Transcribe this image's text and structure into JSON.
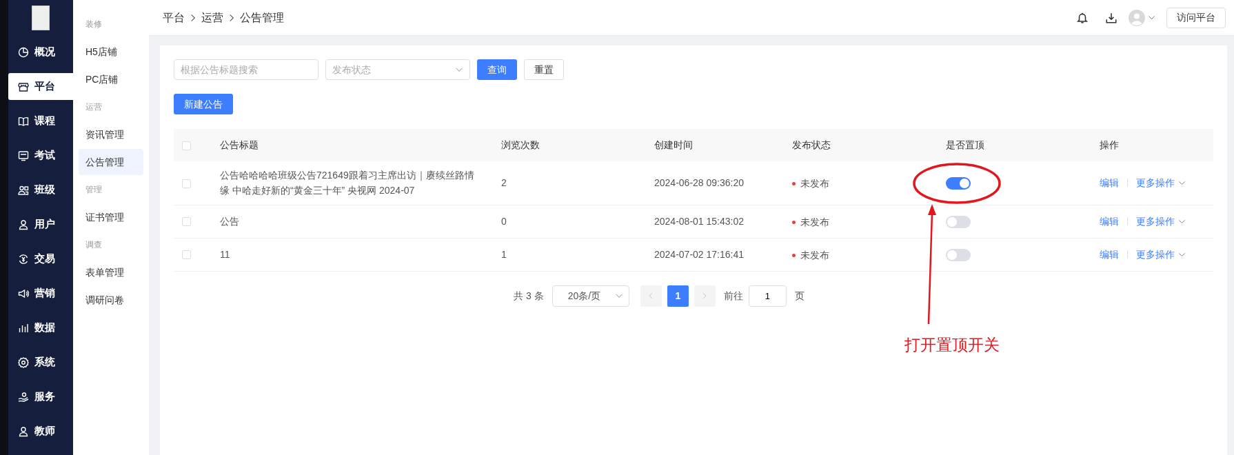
{
  "nav": [
    {
      "label": "概况",
      "selected": false
    },
    {
      "label": "平台",
      "selected": true
    },
    {
      "label": "课程",
      "selected": false
    },
    {
      "label": "考试",
      "selected": false
    },
    {
      "label": "班级",
      "selected": false
    },
    {
      "label": "用户",
      "selected": false
    },
    {
      "label": "交易",
      "selected": false
    },
    {
      "label": "营销",
      "selected": false
    },
    {
      "label": "数据",
      "selected": false
    },
    {
      "label": "系统",
      "selected": false
    },
    {
      "label": "服务",
      "selected": false
    },
    {
      "label": "教师",
      "selected": false
    }
  ],
  "submenu": [
    {
      "group": "装修",
      "items": [
        {
          "label": "H5店铺",
          "selected": false
        },
        {
          "label": "PC店铺",
          "selected": false
        }
      ]
    },
    {
      "group": "运营",
      "items": [
        {
          "label": "资讯管理",
          "selected": false
        },
        {
          "label": "公告管理",
          "selected": true
        }
      ]
    },
    {
      "group": "管理",
      "items": [
        {
          "label": "证书管理",
          "selected": false
        }
      ]
    },
    {
      "group": "调查",
      "items": [
        {
          "label": "表单管理",
          "selected": false
        },
        {
          "label": "调研问卷",
          "selected": false
        }
      ]
    }
  ],
  "breadcrumb": [
    "平台",
    "运营",
    "公告管理"
  ],
  "header_button": "访问平台",
  "filters": {
    "search_placeholder": "根据公告标题搜索",
    "status_placeholder": "发布状态",
    "query_button": "查询",
    "reset_button": "重置"
  },
  "create_button": "新建公告",
  "table": {
    "select_all_checked": false,
    "columns": [
      "公告标题",
      "浏览次数",
      "创建时间",
      "发布状态",
      "是否置顶",
      "操作"
    ],
    "rows": [
      {
        "checked": false,
        "title": "公告哈哈哈哈班级公告721649跟着习主席出访｜赓续丝路情缘 中哈走好新的“黄金三十年” 央视网 2024-07",
        "views": "2",
        "created": "2024-06-28 09:36:20",
        "status": "未发布",
        "pinned": true,
        "actions": [
          "编辑",
          "更多操作"
        ]
      },
      {
        "checked": false,
        "title": "公告",
        "views": "0",
        "created": "2024-08-01 15:43:02",
        "status": "未发布",
        "pinned": false,
        "actions": [
          "编辑",
          "更多操作"
        ]
      },
      {
        "checked": false,
        "title": "11",
        "views": "1",
        "created": "2024-07-02 17:16:41",
        "status": "未发布",
        "pinned": false,
        "actions": [
          "编辑",
          "更多操作"
        ]
      }
    ]
  },
  "pagination": {
    "total": "共 3 条",
    "page_size": "20条/页",
    "pages": [
      {
        "label": "1",
        "selected": true
      }
    ],
    "goto_label": "前往",
    "goto_value": "1",
    "page_suffix": "页"
  },
  "annotation": {
    "text": "打开置顶开关"
  }
}
